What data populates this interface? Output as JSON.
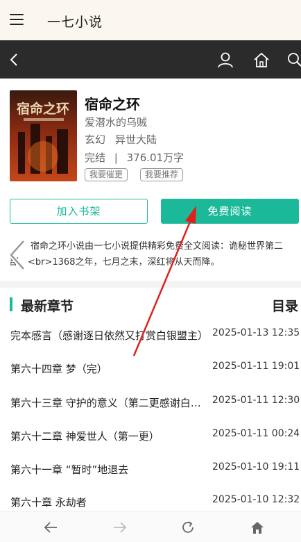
{
  "app": {
    "title": "一七小说"
  },
  "nav": {
    "icons": [
      "back-icon",
      "user-icon",
      "home-icon",
      "search-icon"
    ]
  },
  "book": {
    "title": "宿命之环",
    "author": "爱潜水的乌贼",
    "genres": [
      "玄幻",
      "异世大陆"
    ],
    "status": "完结",
    "word_count": "376.01万字",
    "status_separator": "|",
    "chips": {
      "urge": "我要催更",
      "recommend": "我要推荐"
    }
  },
  "actions": {
    "add_shelf": "加入书架",
    "free_read": "免费阅读"
  },
  "description": {
    "line1": "宿命之环小说由一七小说提供精彩免费全文阅读：诡秘世界第二",
    "line2": "部。<br>1368之年，七月之末，深红将从天而降。"
  },
  "chapters_section": {
    "title": "最新章节",
    "more": "目录"
  },
  "chapters": [
    {
      "name": "完本感言（感谢逐日依然又打赏白银盟主）",
      "date": "2025-01-13 12:35"
    },
    {
      "name": "第六十四章 梦（完）",
      "date": "2025-01-11 19:01"
    },
    {
      "name": "第六十三章 守护的意义（第二更感谢白银盟主）",
      "date": "2025-01-11 12:30"
    },
    {
      "name": "第六十二章 神爱世人（第一更）",
      "date": "2025-01-11 00:24"
    },
    {
      "name": "第六十一章 “暂时”地退去",
      "date": "2025-01-10 19:11"
    },
    {
      "name": "第六十章 永劫者",
      "date": "2025-01-10 12:32"
    }
  ],
  "bottom_toolbar": {
    "icons": [
      "back-arrow-icon",
      "forward-arrow-icon",
      "reload-icon",
      "home-icon"
    ]
  },
  "colors": {
    "accent": "#1bb99a",
    "nav_bg": "#2b2b2b",
    "header_bg": "#fbf7ef",
    "annotation": "#e0201c"
  }
}
